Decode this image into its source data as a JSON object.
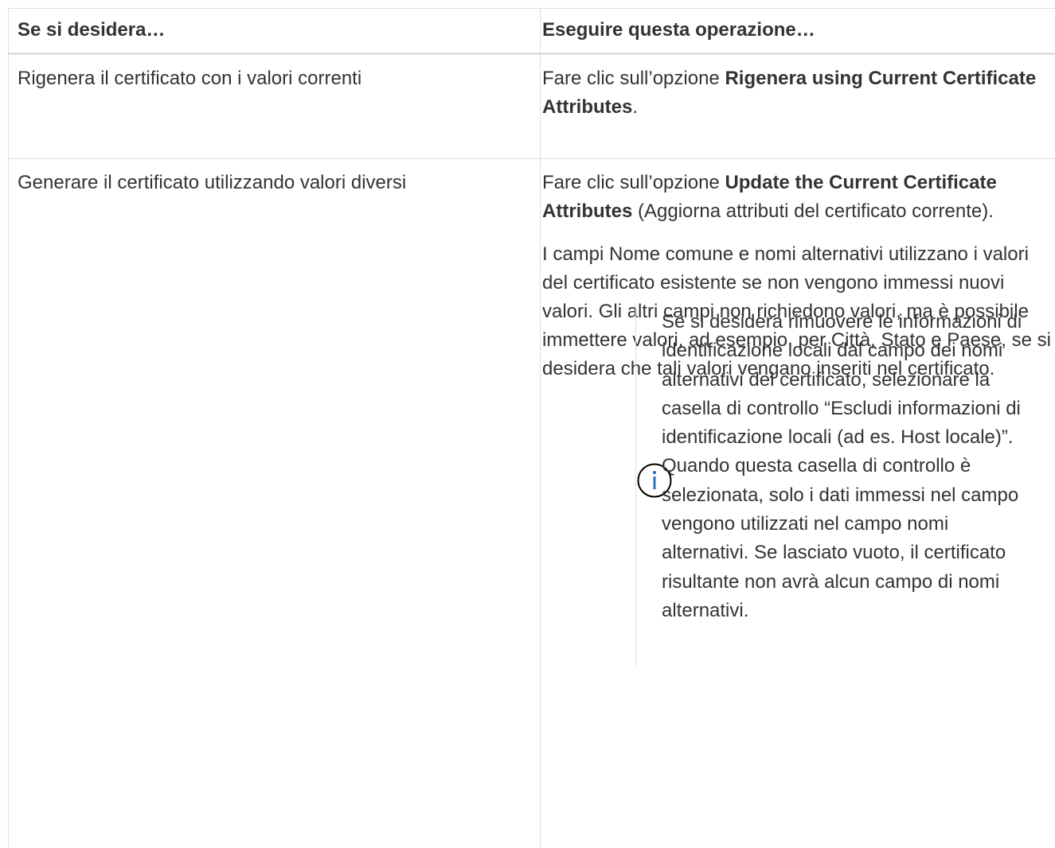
{
  "table": {
    "headers": {
      "col1": "Se si desidera…",
      "col2": "Eseguire questa operazione…"
    },
    "rows": [
      {
        "want": "Rigenera il certificato con i valori correnti",
        "action_prefix": "Fare clic sull’opzione ",
        "action_bold": "Rigenera using Current Certificate Attributes",
        "action_suffix": "."
      },
      {
        "want": "Generare il certificato utilizzando valori diversi",
        "action_prefix": "Fare clic sull’opzione ",
        "action_bold": "Update the Current Certificate Attributes",
        "action_suffix": " (Aggiorna attributi del certificato corrente).",
        "paragraph": "I campi Nome comune e nomi alternativi utilizzano i valori del certificato esistente se non vengono immessi nuovi valori. Gli altri campi non richiedono valori, ma è possibile immettere valori, ad esempio, per Città, Stato e Paese, se si desidera che tali valori vengano inseriti nel certificato.",
        "note": "Se si desidera rimuovere le informazioni di identificazione locali dal campo dei nomi alternativi del certificato, selezionare la casella di controllo “Escludi informazioni di identificazione locali (ad es. Host locale)”. Quando questa casella di controllo è selezionata, solo i dati immessi nel campo vengono utilizzati nel campo nomi alternativi. Se lasciato vuoto, il certificato risultante non avrà alcun campo di nomi alternativi.",
        "note_icon": "info-icon"
      }
    ]
  },
  "colors": {
    "text": "#333333",
    "border": "#dedede"
  }
}
